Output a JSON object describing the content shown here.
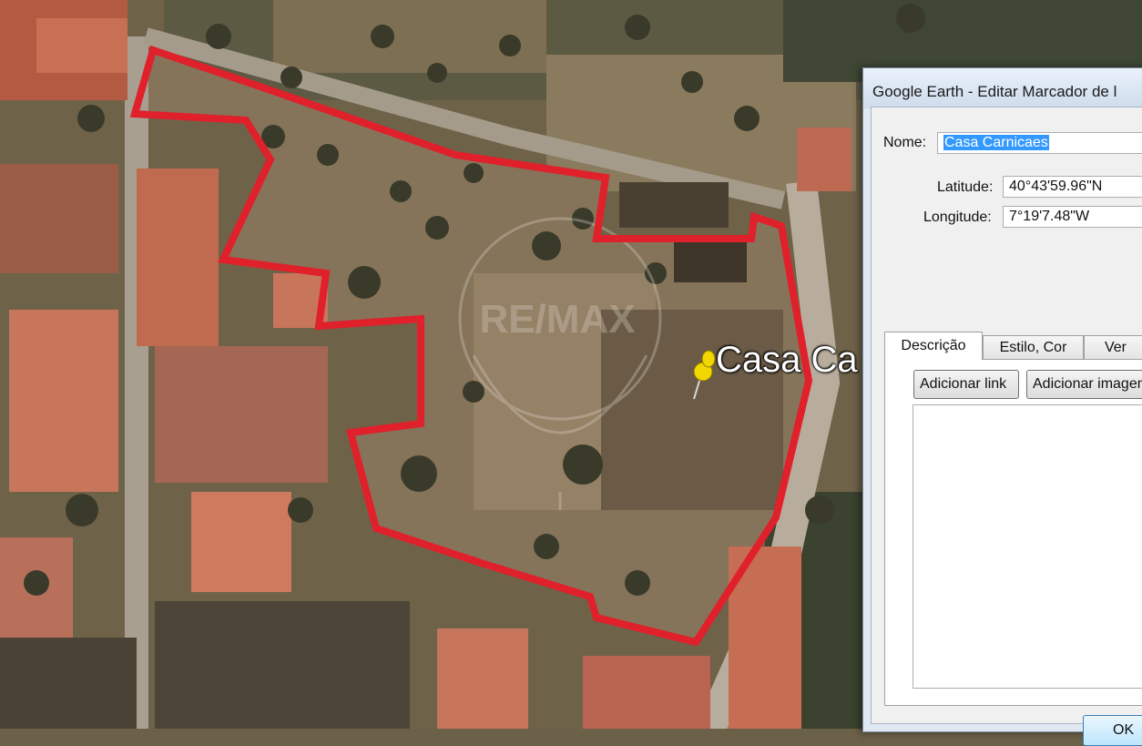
{
  "map": {
    "placemark_label": "Casa Ca",
    "watermark": "RE/MAX",
    "boundary_color": "#e0202a",
    "pin_color": "#f2d600"
  },
  "dialog": {
    "title": "Google Earth - Editar Marcador de l",
    "name_label": "Nome:",
    "name_value": "Casa Carnicaes",
    "latitude_label": "Latitude:",
    "latitude_value": "40°43'59.96\"N",
    "longitude_label": "Longitude:",
    "longitude_value": "7°19'7.48\"W",
    "tabs": [
      {
        "label": "Descrição",
        "active": true
      },
      {
        "label": "Estilo, Cor",
        "active": false
      },
      {
        "label": "Ver",
        "active": false
      }
    ],
    "add_link_label": "Adicionar link",
    "add_image_label": "Adicionar imagem",
    "ok_label": "OK"
  }
}
